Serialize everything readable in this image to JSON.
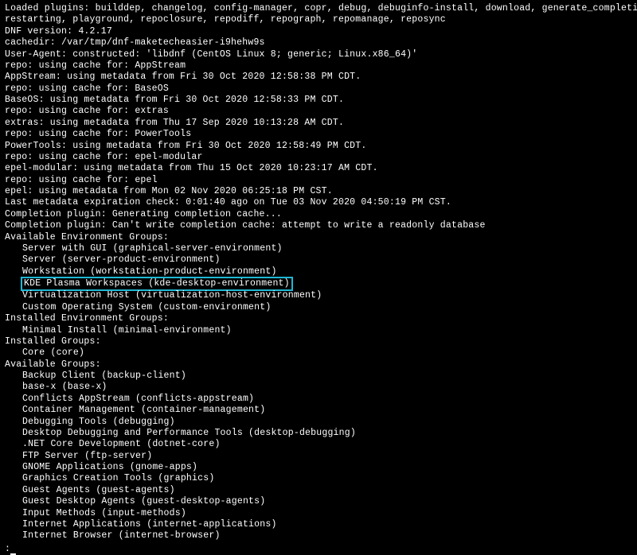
{
  "header": {
    "plugins": "Loaded plugins: builddep, changelog, config-manager, copr, debug, debuginfo-install, download, generate_completion_cache, needs-",
    "plugins2": "restarting, playground, repoclosure, repodiff, repograph, repomanage, reposync",
    "dnf_version": "DNF version: 4.2.17",
    "cachedir": "cachedir: /var/tmp/dnf-maketecheasier-i9hehw9s",
    "user_agent": "User-Agent: constructed: 'libdnf (CentOS Linux 8; generic; Linux.x86_64)'"
  },
  "repos": [
    "repo: using cache for: AppStream",
    "AppStream: using metadata from Fri 30 Oct 2020 12:58:38 PM CDT.",
    "repo: using cache for: BaseOS",
    "BaseOS: using metadata from Fri 30 Oct 2020 12:58:33 PM CDT.",
    "repo: using cache for: extras",
    "extras: using metadata from Thu 17 Sep 2020 10:13:28 AM CDT.",
    "repo: using cache for: PowerTools",
    "PowerTools: using metadata from Fri 30 Oct 2020 12:58:49 PM CDT.",
    "repo: using cache for: epel-modular",
    "epel-modular: using metadata from Thu 15 Oct 2020 10:23:17 AM CDT.",
    "repo: using cache for: epel",
    "epel: using metadata from Mon 02 Nov 2020 06:25:18 PM CST.",
    "Last metadata expiration check: 0:01:40 ago on Tue 03 Nov 2020 04:50:19 PM CST.",
    "Completion plugin: Generating completion cache...",
    "Completion plugin: Can't write completion cache: attempt to write a readonly database"
  ],
  "sections": {
    "avail_env": "Available Environment Groups:",
    "avail_env_items": [
      "Server with GUI (graphical-server-environment)",
      "Server (server-product-environment)",
      "Workstation (workstation-product-environment)"
    ],
    "highlighted": "KDE Plasma Workspaces (kde-desktop-environment)",
    "avail_env_items2": [
      "Virtualization Host (virtualization-host-environment)",
      "Custom Operating System (custom-environment)"
    ],
    "installed_env": "Installed Environment Groups:",
    "installed_env_items": [
      "Minimal Install (minimal-environment)"
    ],
    "installed_groups": "Installed Groups:",
    "installed_groups_items": [
      "Core (core)"
    ],
    "avail_groups": "Available Groups:",
    "avail_groups_items": [
      "Backup Client (backup-client)",
      "base-x (base-x)",
      "Conflicts AppStream (conflicts-appstream)",
      "Container Management (container-management)",
      "Debugging Tools (debugging)",
      "Desktop Debugging and Performance Tools (desktop-debugging)",
      ".NET Core Development (dotnet-core)",
      "FTP Server (ftp-server)",
      "GNOME Applications (gnome-apps)",
      "Graphics Creation Tools (graphics)",
      "Guest Agents (guest-agents)",
      "Guest Desktop Agents (guest-desktop-agents)",
      "Input Methods (input-methods)",
      "Internet Applications (internet-applications)",
      "Internet Browser (internet-browser)"
    ]
  }
}
